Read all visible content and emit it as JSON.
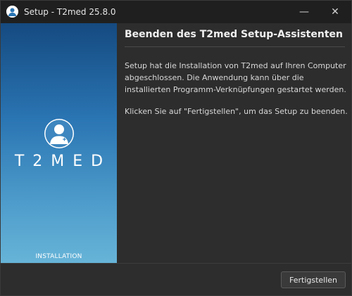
{
  "window": {
    "title": "Setup - T2med 25.8.0",
    "minimize_symbol": "—",
    "close_symbol": "✕"
  },
  "banner": {
    "logo_text": "T2MED",
    "footer_text": "INSTALLATION",
    "gradient_top": "#154a80",
    "gradient_bottom": "#67b4d8"
  },
  "content": {
    "title": "Beenden des T2med Setup-Assistenten",
    "paragraph1": "Setup hat die Installation von T2med auf Ihren Computer abgeschlossen. Die Anwendung kann über die installierten Programm-Verknüpfungen gestartet werden.",
    "paragraph2": "Klicken Sie auf \"Fertigstellen\", um das Setup zu beenden."
  },
  "footer": {
    "finish_label": "Fertigstellen"
  },
  "icons": [
    "app-logo-icon",
    "minimize-icon",
    "close-icon",
    "doctor-avatar-icon"
  ]
}
